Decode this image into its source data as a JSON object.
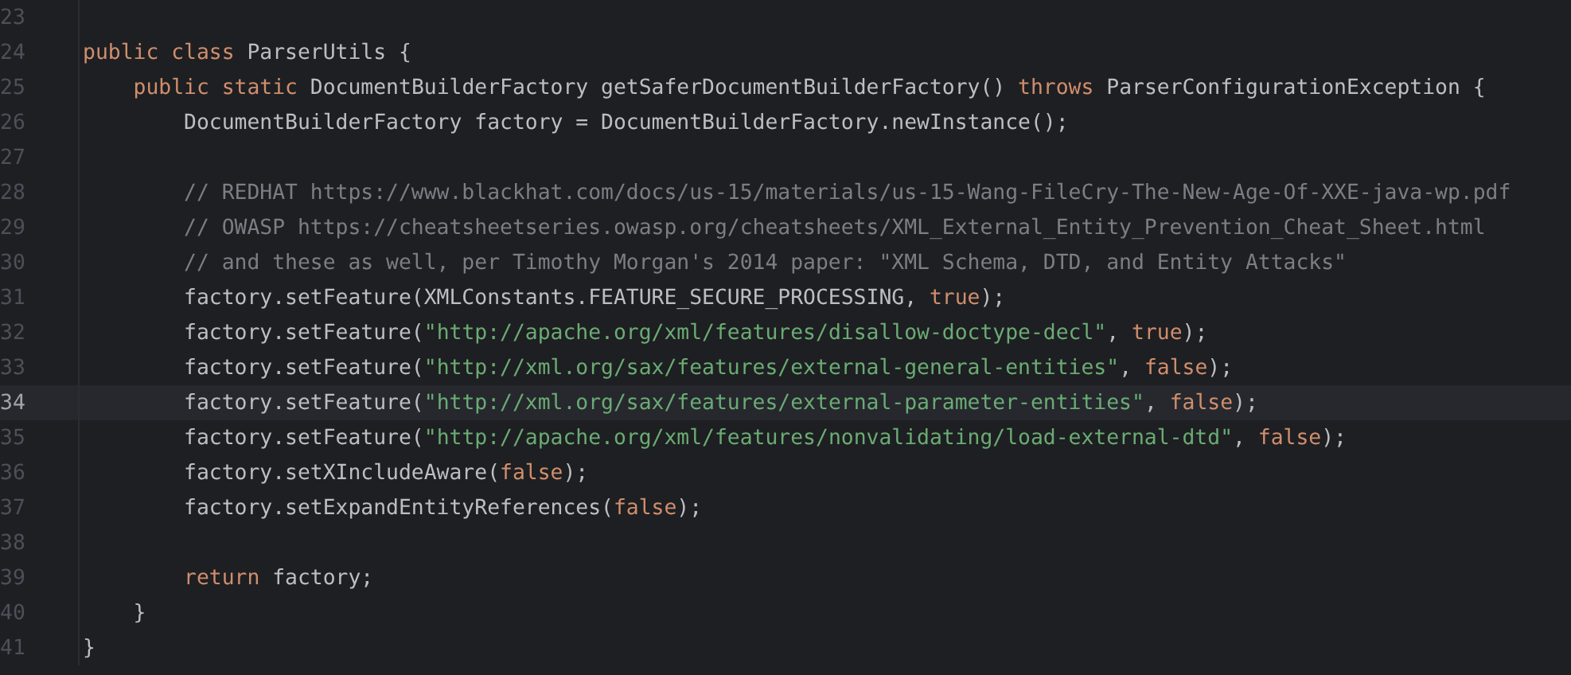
{
  "editor": {
    "lines": [
      {
        "number": "23",
        "current": false
      },
      {
        "number": "24",
        "current": false,
        "tokens": [
          {
            "kind": "keyword",
            "text": "public class "
          },
          {
            "kind": "plain",
            "text": "ParserUtils {"
          }
        ]
      },
      {
        "number": "25",
        "current": false,
        "tokens": [
          {
            "kind": "keyword",
            "text": "    public static "
          },
          {
            "kind": "plain",
            "text": "DocumentBuilderFactory getSaferDocumentBuilderFactory() "
          },
          {
            "kind": "keyword",
            "text": "throws "
          },
          {
            "kind": "plain",
            "text": "ParserConfigurationException {"
          }
        ]
      },
      {
        "number": "26",
        "current": false,
        "tokens": [
          {
            "kind": "plain",
            "text": "        DocumentBuilderFactory factory = DocumentBuilderFactory.newInstance();"
          }
        ]
      },
      {
        "number": "27",
        "current": false
      },
      {
        "number": "28",
        "current": false,
        "tokens": [
          {
            "kind": "comment",
            "text": "        // REDHAT https://www.blackhat.com/docs/us-15/materials/us-15-Wang-FileCry-The-New-Age-Of-XXE-java-wp.pdf"
          }
        ]
      },
      {
        "number": "29",
        "current": false,
        "tokens": [
          {
            "kind": "comment",
            "text": "        // OWASP https://cheatsheetseries.owasp.org/cheatsheets/XML_External_Entity_Prevention_Cheat_Sheet.html"
          }
        ]
      },
      {
        "number": "30",
        "current": false,
        "tokens": [
          {
            "kind": "comment",
            "text": "        // and these as well, per Timothy Morgan's 2014 paper: \"XML Schema, DTD, and Entity Attacks\""
          }
        ]
      },
      {
        "number": "31",
        "current": false,
        "tokens": [
          {
            "kind": "plain",
            "text": "        factory.setFeature(XMLConstants.FEATURE_SECURE_PROCESSING, "
          },
          {
            "kind": "keyword",
            "text": "true"
          },
          {
            "kind": "plain",
            "text": ");"
          }
        ]
      },
      {
        "number": "32",
        "current": false,
        "tokens": [
          {
            "kind": "plain",
            "text": "        factory.setFeature("
          },
          {
            "kind": "string",
            "text": "\"http://apache.org/xml/features/disallow-doctype-decl\""
          },
          {
            "kind": "plain",
            "text": ", "
          },
          {
            "kind": "keyword",
            "text": "true"
          },
          {
            "kind": "plain",
            "text": ");"
          }
        ]
      },
      {
        "number": "33",
        "current": false,
        "tokens": [
          {
            "kind": "plain",
            "text": "        factory.setFeature("
          },
          {
            "kind": "string",
            "text": "\"http://xml.org/sax/features/external-general-entities\""
          },
          {
            "kind": "plain",
            "text": ", "
          },
          {
            "kind": "keyword",
            "text": "false"
          },
          {
            "kind": "plain",
            "text": ");"
          }
        ]
      },
      {
        "number": "34",
        "current": true,
        "tokens": [
          {
            "kind": "plain",
            "text": "        factory.setFeature("
          },
          {
            "kind": "string",
            "text": "\"http://xml.org/sax/features/external-parameter-entities\""
          },
          {
            "kind": "plain",
            "text": ", "
          },
          {
            "kind": "keyword",
            "text": "false"
          },
          {
            "kind": "plain",
            "text": ");"
          }
        ]
      },
      {
        "number": "35",
        "current": false,
        "tokens": [
          {
            "kind": "plain",
            "text": "        factory.setFeature("
          },
          {
            "kind": "string",
            "text": "\"http://apache.org/xml/features/nonvalidating/load-external-dtd\""
          },
          {
            "kind": "plain",
            "text": ", "
          },
          {
            "kind": "keyword",
            "text": "false"
          },
          {
            "kind": "plain",
            "text": ");"
          }
        ]
      },
      {
        "number": "36",
        "current": false,
        "tokens": [
          {
            "kind": "plain",
            "text": "        factory.setXIncludeAware("
          },
          {
            "kind": "keyword",
            "text": "false"
          },
          {
            "kind": "plain",
            "text": ");"
          }
        ]
      },
      {
        "number": "37",
        "current": false,
        "tokens": [
          {
            "kind": "plain",
            "text": "        factory.setExpandEntityReferences("
          },
          {
            "kind": "keyword",
            "text": "false"
          },
          {
            "kind": "plain",
            "text": ");"
          }
        ]
      },
      {
        "number": "38",
        "current": false
      },
      {
        "number": "39",
        "current": false,
        "tokens": [
          {
            "kind": "keyword",
            "text": "        return "
          },
          {
            "kind": "plain",
            "text": "factory;"
          }
        ]
      },
      {
        "number": "40",
        "current": false,
        "tokens": [
          {
            "kind": "plain",
            "text": "    }"
          }
        ]
      },
      {
        "number": "41",
        "current": false,
        "tokens": [
          {
            "kind": "plain",
            "text": "}"
          }
        ]
      }
    ]
  }
}
